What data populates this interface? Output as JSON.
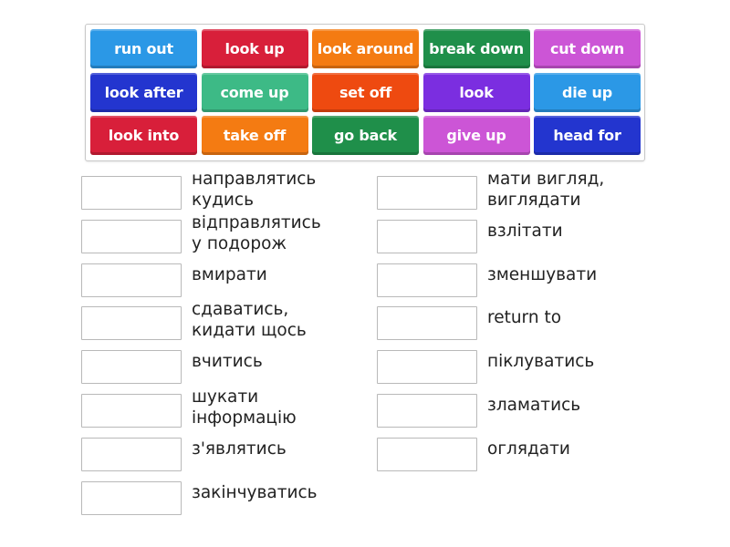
{
  "tiles": [
    {
      "label": "run out",
      "color": "#2b98e6"
    },
    {
      "label": "look up",
      "color": "#d81f3a"
    },
    {
      "label": "look around",
      "color": "#f47b12"
    },
    {
      "label": "break down",
      "color": "#1f8f4a"
    },
    {
      "label": "cut down",
      "color": "#cc55d6"
    },
    {
      "label": "look after",
      "color": "#2335cf"
    },
    {
      "label": "come up",
      "color": "#3dba86"
    },
    {
      "label": "set off",
      "color": "#ee4a10"
    },
    {
      "label": "look",
      "color": "#7b2ee0"
    },
    {
      "label": "die up",
      "color": "#2b98e6"
    },
    {
      "label": "look into",
      "color": "#d81f3a"
    },
    {
      "label": "take off",
      "color": "#f47b12"
    },
    {
      "label": "go back",
      "color": "#1f8f4a"
    },
    {
      "label": "give up",
      "color": "#cc55d6"
    },
    {
      "label": "head for",
      "color": "#2335cf"
    }
  ],
  "left_items": [
    {
      "label": "направлятись\nкудись"
    },
    {
      "label": "відправлятись\nу подорож"
    },
    {
      "label": "вмирати"
    },
    {
      "label": "сдаватись,\nкидати щось"
    },
    {
      "label": "вчитись"
    },
    {
      "label": "шукати\nінформацію"
    },
    {
      "label": "з'являтись"
    },
    {
      "label": "закінчуватись"
    }
  ],
  "right_items": [
    {
      "label": "мати вигляд,\nвиглядати"
    },
    {
      "label": "взлітати"
    },
    {
      "label": "зменшувати"
    },
    {
      "label": "return to"
    },
    {
      "label": "піклуватись"
    },
    {
      "label": "зламатись"
    },
    {
      "label": "оглядати"
    }
  ]
}
